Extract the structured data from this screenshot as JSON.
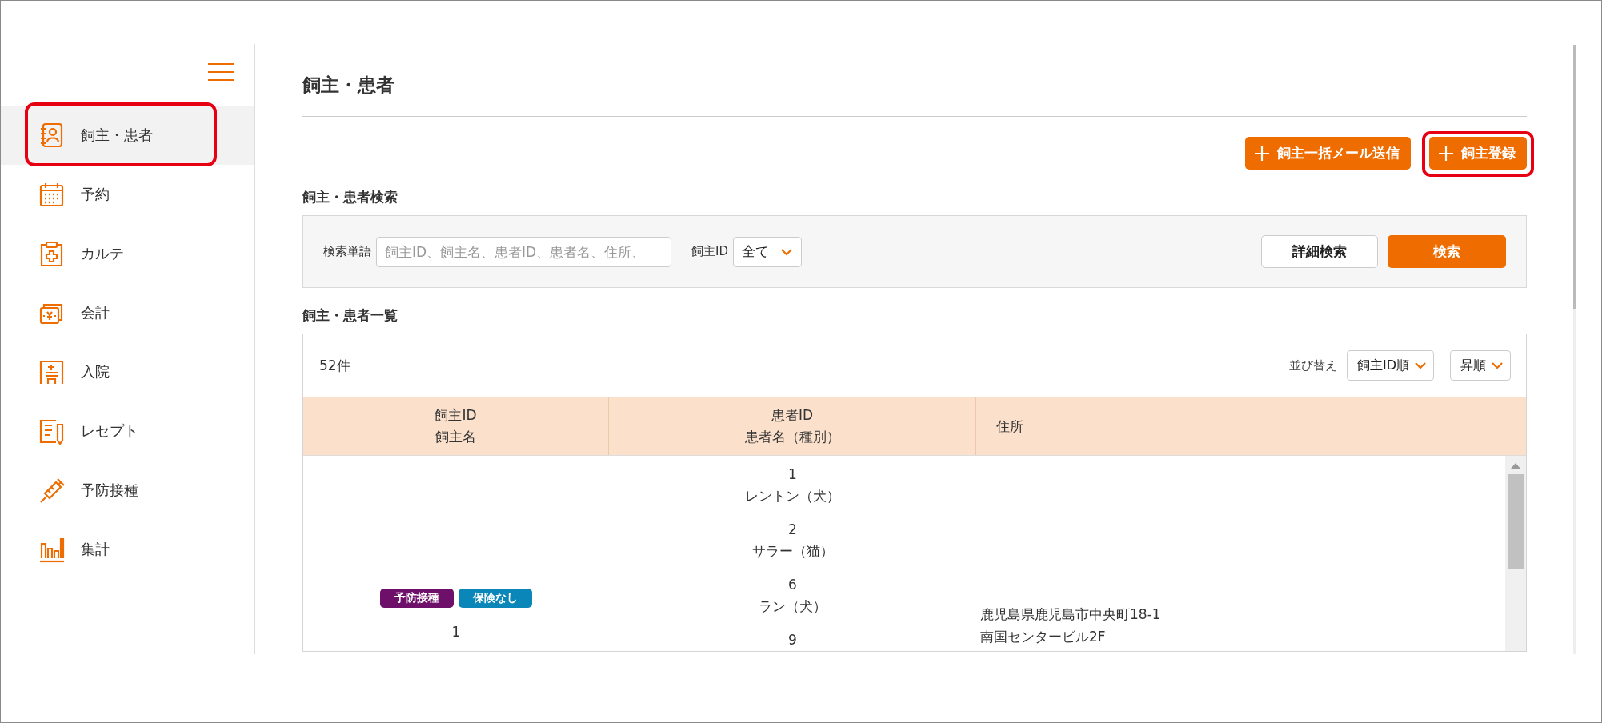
{
  "sidebar": {
    "items": [
      {
        "label": "飼主・患者",
        "selected": true,
        "highlighted": true
      },
      {
        "label": "予約",
        "selected": false,
        "highlighted": false
      },
      {
        "label": "カルテ",
        "selected": false,
        "highlighted": false
      },
      {
        "label": "会計",
        "selected": false,
        "highlighted": false
      },
      {
        "label": "入院",
        "selected": false,
        "highlighted": false
      },
      {
        "label": "レセプト",
        "selected": false,
        "highlighted": false
      },
      {
        "label": "予防接種",
        "selected": false,
        "highlighted": false
      },
      {
        "label": "集計",
        "selected": false,
        "highlighted": false
      }
    ]
  },
  "page": {
    "title": "飼主・患者"
  },
  "actions": [
    {
      "label": "飼主一括メール送信",
      "highlighted": false
    },
    {
      "label": "飼主登録",
      "highlighted": true
    }
  ],
  "search": {
    "heading": "飼主・患者検索",
    "keyword": {
      "label": "検索単語",
      "placeholder": "飼主ID、飼主名、患者ID、患者名、住所、"
    },
    "owner_id": {
      "label": "飼主ID",
      "value": "全て"
    },
    "detail_button": "詳細検索",
    "search_button": "検索"
  },
  "list": {
    "heading": "飼主・患者一覧",
    "count": "52件",
    "sort_label": "並び替え",
    "sort_field": "飼主ID順",
    "sort_order": "昇順",
    "columns": [
      {
        "lines": [
          "飼主ID",
          "飼主名"
        ]
      },
      {
        "lines": [
          "患者ID",
          "患者名（種別）"
        ]
      },
      {
        "lines": [
          "住所"
        ]
      }
    ],
    "rows": [
      {
        "badges": [
          {
            "label": "予防接種",
            "color": "#6e0f6a"
          },
          {
            "label": "保険なし",
            "color": "#0a86b8"
          }
        ],
        "owner_id": "1",
        "patients": [
          {
            "id": "1",
            "name": "レントン（犬）"
          },
          {
            "id": "2",
            "name": "サラー（猫）"
          },
          {
            "id": "6",
            "name": "ラン（犬）"
          },
          {
            "id": "9"
          }
        ],
        "address": [
          "鹿児島県鹿児島市中央町18-1",
          "南国センタービル2F"
        ]
      }
    ]
  }
}
